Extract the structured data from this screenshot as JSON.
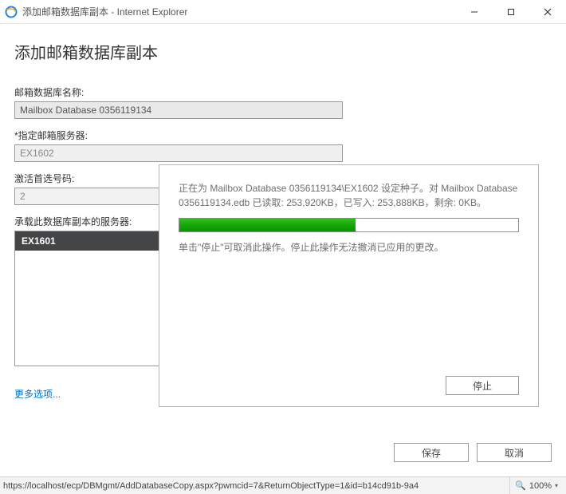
{
  "window": {
    "title": "添加邮箱数据库副本 - Internet Explorer"
  },
  "page": {
    "title": "添加邮箱数据库副本",
    "db_name_label": "邮箱数据库名称:",
    "db_name_value": "Mailbox Database 0356119134",
    "server_label": "*指定邮箱服务器:",
    "server_value": "EX1602",
    "pref_label": "激活首选号码:",
    "pref_value": "2",
    "hosts_label": "承载此数据库副本的服务器:",
    "host_values": [
      "EX1601"
    ],
    "more_options": "更多选项...",
    "save_label": "保存",
    "cancel_label": "取消"
  },
  "modal": {
    "progress_text": "正在为 Mailbox Database 0356119134\\EX1602 设定种子。对 Mailbox Database 0356119134.edb 已读取: 253,920KB，已写入: 253,888KB，剩余: 0KB。",
    "hint_text": "单击\"停止\"可取消此操作。停止此操作无法撤消已应用的更改。",
    "stop_label": "停止",
    "progress_percent": 52
  },
  "statusbar": {
    "url": "https://localhost/ecp/DBMgmt/AddDatabaseCopy.aspx?pwmcid=7&ReturnObjectType=1&id=b14cd91b-9a4",
    "zoom": "100%"
  }
}
